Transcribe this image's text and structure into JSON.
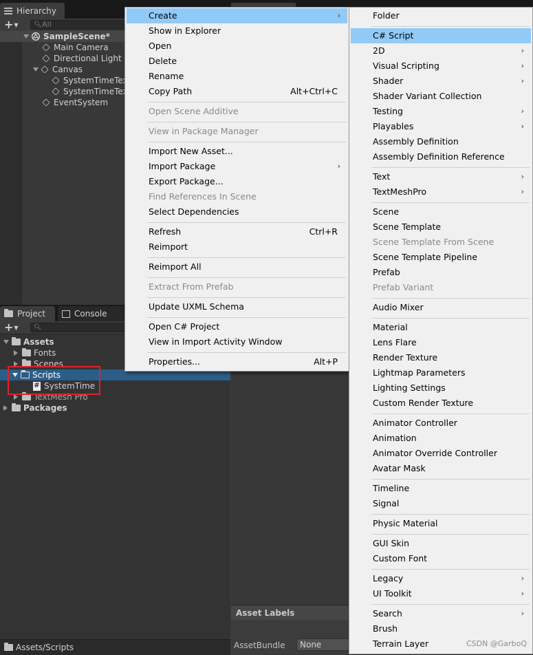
{
  "hierarchy": {
    "tab": "Hierarchy",
    "search_placeholder": "All",
    "scene": "SampleScene*",
    "items": [
      "Main Camera",
      "Directional Light",
      "Canvas",
      "SystemTimeTex",
      "SystemTimeTex",
      "EventSystem"
    ]
  },
  "project": {
    "tabs": [
      "Project",
      "Console"
    ],
    "tree": {
      "assets": "Assets",
      "fonts": "Fonts",
      "scenes": "Scenes",
      "scripts": "Scripts",
      "system_time": "SystemTime",
      "textmesh": "TextMesh Pro",
      "packages": "Packages"
    },
    "status_path": "Assets/Scripts"
  },
  "inspector": {
    "asset_labels": "Asset Labels",
    "asset_bundle_label": "AssetBundle",
    "asset_bundle_value": "None"
  },
  "main_menu": [
    {
      "label": "Create",
      "submenu": true,
      "highlighted": true
    },
    {
      "label": "Show in Explorer"
    },
    {
      "label": "Open"
    },
    {
      "label": "Delete"
    },
    {
      "label": "Rename"
    },
    {
      "label": "Copy Path",
      "shortcut": "Alt+Ctrl+C"
    },
    {
      "label": "Open Scene Additive",
      "disabled": true
    },
    {
      "label": "View in Package Manager",
      "disabled": true
    },
    {
      "label": "Import New Asset..."
    },
    {
      "label": "Import Package",
      "submenu": true
    },
    {
      "label": "Export Package..."
    },
    {
      "label": "Find References In Scene",
      "disabled": true
    },
    {
      "label": "Select Dependencies"
    },
    {
      "label": "Refresh",
      "shortcut": "Ctrl+R"
    },
    {
      "label": "Reimport"
    },
    {
      "label": "Reimport All"
    },
    {
      "label": "Extract From Prefab",
      "disabled": true
    },
    {
      "label": "Update UXML Schema"
    },
    {
      "label": "Open C# Project"
    },
    {
      "label": "View in Import Activity Window"
    },
    {
      "label": "Properties...",
      "shortcut": "Alt+P"
    }
  ],
  "create_menu": [
    {
      "label": "Folder"
    },
    {
      "label": "C# Script",
      "highlighted": true
    },
    {
      "label": "2D",
      "submenu": true
    },
    {
      "label": "Visual Scripting",
      "submenu": true
    },
    {
      "label": "Shader",
      "submenu": true
    },
    {
      "label": "Shader Variant Collection"
    },
    {
      "label": "Testing",
      "submenu": true
    },
    {
      "label": "Playables",
      "submenu": true
    },
    {
      "label": "Assembly Definition"
    },
    {
      "label": "Assembly Definition Reference"
    },
    {
      "label": "Text",
      "submenu": true
    },
    {
      "label": "TextMeshPro",
      "submenu": true
    },
    {
      "label": "Scene"
    },
    {
      "label": "Scene Template"
    },
    {
      "label": "Scene Template From Scene",
      "disabled": true
    },
    {
      "label": "Scene Template Pipeline"
    },
    {
      "label": "Prefab"
    },
    {
      "label": "Prefab Variant",
      "disabled": true
    },
    {
      "label": "Audio Mixer"
    },
    {
      "label": "Material"
    },
    {
      "label": "Lens Flare"
    },
    {
      "label": "Render Texture"
    },
    {
      "label": "Lightmap Parameters"
    },
    {
      "label": "Lighting Settings"
    },
    {
      "label": "Custom Render Texture"
    },
    {
      "label": "Animator Controller"
    },
    {
      "label": "Animation"
    },
    {
      "label": "Animator Override Controller"
    },
    {
      "label": "Avatar Mask"
    },
    {
      "label": "Timeline"
    },
    {
      "label": "Signal"
    },
    {
      "label": "Physic Material"
    },
    {
      "label": "GUI Skin"
    },
    {
      "label": "Custom Font"
    },
    {
      "label": "Legacy",
      "submenu": true
    },
    {
      "label": "UI Toolkit",
      "submenu": true
    },
    {
      "label": "Search",
      "submenu": true
    },
    {
      "label": "Brush"
    },
    {
      "label": "Terrain Layer"
    }
  ],
  "watermark": "CSDN @GarboQ",
  "colors": {
    "highlight": "#91c9f7",
    "selection": "#2c5d87",
    "red_box": "#e0222b"
  }
}
